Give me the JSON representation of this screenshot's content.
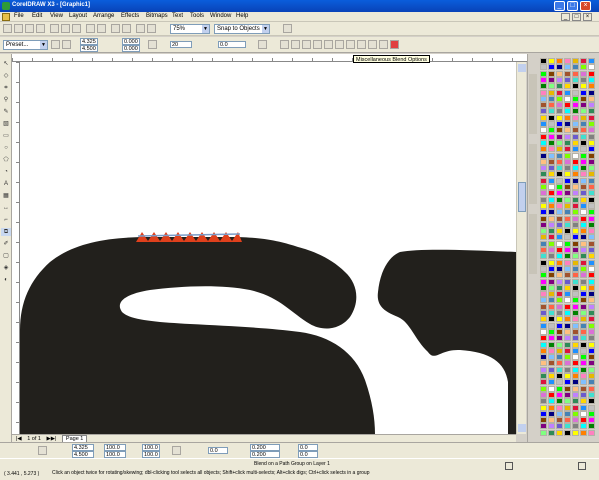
{
  "window": {
    "title": "CorelDRAW X3 - [Graphic1]",
    "minimize": "_",
    "maximize": "□",
    "close": "×"
  },
  "menu": [
    "File",
    "Edit",
    "View",
    "Layout",
    "Arrange",
    "Effects",
    "Bitmaps",
    "Text",
    "Tools",
    "Window",
    "Help"
  ],
  "standard_toolbar": {
    "zoom_value": "75%",
    "snap_value": "Snap to Objects"
  },
  "property_bar": {
    "preset": "Preset...",
    "x_value": "4.325",
    "y_value": "4.500",
    "w_value": "0.000",
    "h_value": "0.000",
    "steps_value": "20",
    "rotation_value": "0.0"
  },
  "tooltip": "Miscellaneous Blend Options",
  "page_nav": {
    "counter": "1 of 1",
    "page_tab": "Page 1"
  },
  "bottom_toolbar": {
    "x1": "4.325",
    "y1": "4.500",
    "w1": "100.0",
    "h1": "100.0",
    "angle": "0.0",
    "x2": "0.200",
    "y2": "0.200",
    "nudge1": "0.0",
    "nudge2": "0.0"
  },
  "status": {
    "line1": "Blend on a Path Group on Layer 1",
    "line2": "Click an object twice for rotating/skewing; dbl-clicking tool selects all objects; Shift+click multi-selects; Alt+click digs; Ctrl+click selects in a group",
    "left_text": "( 3.441 , 5.273 )"
  },
  "colors": {
    "title_bar": "#0943b8",
    "shape_fill": "#22201c",
    "blend_red": "#e0401c",
    "blend_blue": "#7a9cc8",
    "chrome": "#ece9d8"
  },
  "icons": [
    "document-icon",
    "new-icon",
    "open-icon",
    "save-icon",
    "print-icon",
    "cut-icon",
    "copy-icon",
    "paste-icon",
    "undo-icon",
    "redo-icon",
    "import-icon",
    "export-icon",
    "zoom-icon",
    "help-icon",
    "blend-options-icon",
    "pick-tool-icon",
    "shape-tool-icon",
    "crop-tool-icon",
    "zoom-tool-icon",
    "freehand-tool-icon",
    "rectangle-tool-icon",
    "ellipse-tool-icon",
    "polygon-tool-icon",
    "text-tool-icon",
    "blend-tool-icon",
    "eyedropper-tool-icon",
    "outline-tool-icon",
    "fill-tool-icon"
  ],
  "palette_colors": [
    "#000000",
    "#ffffff",
    "#808080",
    "#c0c0c0",
    "#ff0000",
    "#ffff00",
    "#00ff00",
    "#00ffff",
    "#0000ff",
    "#ff00ff",
    "#ff8000",
    "#804000",
    "#008000",
    "#000080",
    "#800080",
    "#ff80c0",
    "#ffc080",
    "#80ff80",
    "#80c0ff",
    "#c080ff",
    "#e6b800",
    "#a0522d",
    "#2e8b57",
    "#4682b4",
    "#6a5acd",
    "#dc143c",
    "#ff6347",
    "#ffd700",
    "#7fff00",
    "#40e0d0",
    "#1e90ff",
    "#da70d6"
  ]
}
